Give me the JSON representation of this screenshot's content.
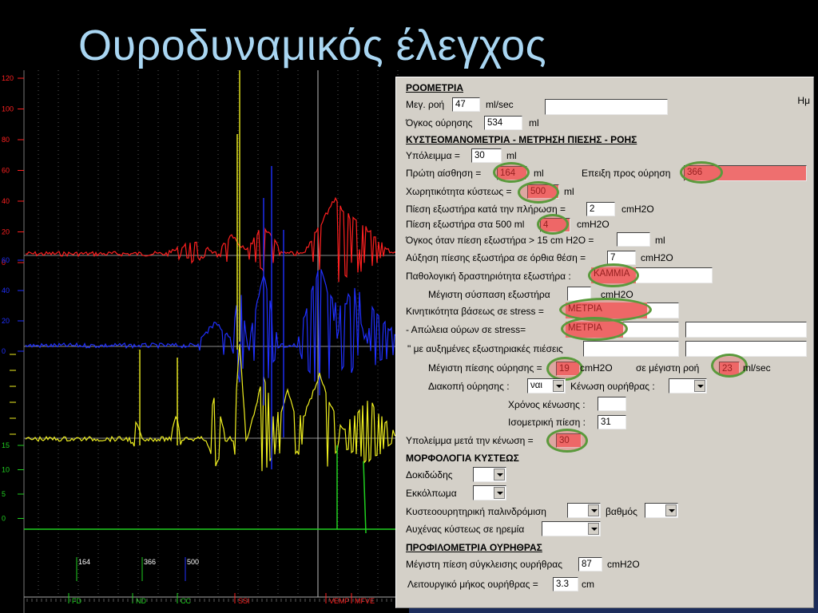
{
  "slide": {
    "title": "Ουροδυναμικός έλεγχος"
  },
  "chart": {
    "left_axis": {
      "ticks_top": [
        "120",
        "100",
        "80",
        "60",
        "40",
        "20",
        "0"
      ],
      "ticks_mid": [
        "60",
        "40",
        "20",
        "0"
      ],
      "ticks_bottom": [
        "15",
        "10",
        "5",
        "0"
      ]
    },
    "markers": [
      "164",
      "366",
      "500"
    ],
    "events": [
      "FD",
      "ND",
      "CC",
      "SSI",
      "VEMP",
      "MFVE"
    ],
    "colors": {
      "red": "#ff2020",
      "blue": "#2030ff",
      "yellow": "#f0f020",
      "green": "#20d020",
      "grid": "#8a8a8a"
    }
  },
  "form": {
    "corner_label": "Ημ",
    "uroflow": {
      "heading": "ΡΟΟΜΕΤΡΙΑ",
      "max_flow_label": "Μεγ. ροή",
      "max_flow_value": "47",
      "max_flow_unit": "ml/sec",
      "void_volume_label": "Όγκος ούρησης",
      "void_volume_value": "534",
      "void_volume_unit": "ml"
    },
    "cysto": {
      "heading": "ΚΥΣΤΕΟΜΑΝΟΜΕΤΡΙΑ - ΜΕΤΡΗΣΗ ΠΙΕΣΗΣ - ΡΟΗΣ",
      "residual_label": "Υπόλειμμα =",
      "residual_value": "30",
      "residual_unit": "ml",
      "first_sensation_label": "Πρώτη αίσθηση =",
      "first_sensation_value": "164",
      "first_sensation_unit": "ml",
      "urge_label": "Επειξη προς ούρηση",
      "urge_value": "366",
      "capacity_label": "Χωρητικότητα κύστεως =",
      "capacity_value": "500",
      "capacity_unit": "ml",
      "detrusor_fill_label": "Πίεση εξωστήρα κατά την πλήρωση =",
      "detrusor_fill_value": "2",
      "detrusor_fill_unit": "cmH2O",
      "detrusor_500_label": "Πίεση εξωστήρα στα 500 ml",
      "detrusor_500_value": "4",
      "detrusor_500_unit": "cmH2O",
      "volume_15_label": "Όγκος όταν πίεση εξωστήρα > 15 cm H2O =",
      "volume_15_value": "",
      "volume_15_unit": "ml",
      "upright_label": "Αύξηση πίεσης εξωστήρα σε όρθια θέση =",
      "upright_value": "7",
      "upright_unit": "cmH2O",
      "pathologic_label": "Παθολογική δραστηριότητα εξωστήρα :",
      "pathologic_value": "ΚΑΜΜΙΑ",
      "max_contraction_label": "Μέγιστη σύσπαση εξωστήρα",
      "max_contraction_value": "",
      "max_contraction_unit": "cmH2O",
      "base_mobility_label": "Κινητικότητα βάσεως σε stress =",
      "base_mobility_value": "ΜΕΤΡΙΑ",
      "urine_loss_label": "- Απώλεια ούρων σε stress=",
      "urine_loss_value": "ΜΕΤΡΙΑ",
      "urine_loss_extra": "",
      "increased_label": "\" με αυξημένες εξωστηριακές πιέσεις",
      "increased_value": "",
      "increased_extra": "",
      "max_void_pressure_label": "Μέγιστη πίεσης ούρησης =",
      "max_void_pressure_value": "19",
      "max_void_pressure_unit": "cmH2O",
      "at_max_flow_label": "σε μέγιστη ροή",
      "at_max_flow_value": "23",
      "at_max_flow_unit": "ml/sec",
      "interruption_label": "Διακοπή ούρησης :",
      "interruption_value": "ναι",
      "urethra_empty_label": "Κένωση ουρήθρας :",
      "urethra_empty_value": "",
      "empty_time_label": "Χρόνος κένωσης :",
      "empty_time_value": "",
      "isometric_label": "Ισομετρική πίεση :",
      "isometric_value": "31",
      "post_void_label": "Υπολείμμα μετά την κένωση =",
      "post_void_value": "30"
    },
    "morphology": {
      "heading": "ΜΟΡΦΟΛΟΓΙΑ ΚΥΣΤΕΩΣ",
      "trabeculation_label": "Δοκιδώδης",
      "diverticulum_label": "Εκκόλπωμα",
      "reflux_label": "Κυστεοουρητηρική παλινδρόμιση",
      "grade_label": "βαθμός",
      "bladder_neck_label": "Αυχένας κύστεως σε ηρεμία"
    },
    "profilometry": {
      "heading": "ΠΡΟΦΙΛΟΜΕΤΡΙΑ ΟΥΡΗΘΡΑΣ",
      "closure_label": "Μέγιστη πίεση σύγκλεισης ουρήθρας",
      "closure_value": "87",
      "closure_unit": "cmH2O",
      "length_label": "Λειτουργικό μήκος ουρήθρας =",
      "length_value": "3.3",
      "length_unit": "cm"
    }
  }
}
